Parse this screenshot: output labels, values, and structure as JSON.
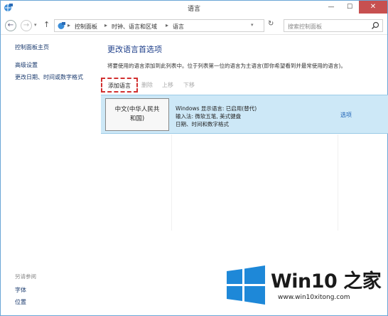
{
  "window": {
    "title": "语言",
    "minimize_label": "—",
    "maximize_label": "☐",
    "close_label": "✕"
  },
  "address": {
    "crumbs": [
      "控制面板",
      "时钟、语言和区域",
      "语言"
    ],
    "search_placeholder": "搜索控制面板"
  },
  "sidebar": {
    "home": "控制面板主页",
    "links": [
      "高级设置",
      "更改日期、时间或数字格式"
    ],
    "see_also_heading": "另请参阅",
    "see_also": [
      "字体",
      "位置"
    ]
  },
  "main": {
    "title": "更改语言首选项",
    "description": "将要使用的语言添加到此列表中。位于列表第一位的语言为主语言(即你希望看到并最常使用的语言)。",
    "toolbar": {
      "add": "添加语言",
      "remove": "删除",
      "up": "上移",
      "down": "下移"
    },
    "languages": [
      {
        "name_line1": "中文(中华人民共",
        "name_line2": "和国)",
        "info": [
          "Windows 显示语言: 已启用(替代)",
          "输入法: 微软五笔, 美式键盘",
          "日期、时间和数字格式"
        ],
        "options": "选项"
      }
    ]
  },
  "watermark": {
    "brand": "Win10 之家",
    "url": "www.win10xitong.com",
    "colors": {
      "logo": "#1e88d8"
    }
  }
}
